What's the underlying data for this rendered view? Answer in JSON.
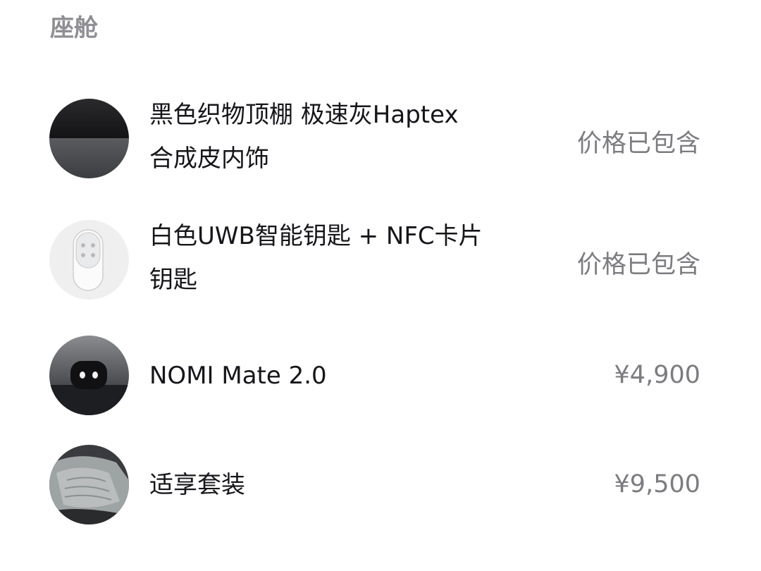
{
  "section": {
    "title": "座舱"
  },
  "items": [
    {
      "name_line1": "黑色织物顶棚 极速灰Haptex",
      "name_line2": "合成皮内饰",
      "price": "价格已包含",
      "image_icon": "black-fabric-headliner-swatch"
    },
    {
      "name_line1": "白色UWB智能钥匙 + NFC卡片",
      "name_line2": "钥匙",
      "price": "价格已包含",
      "image_icon": "white-smart-key"
    },
    {
      "name_line1": "NOMI Mate 2.0",
      "price": "¥4,900",
      "image_icon": "nomi-mate-device"
    },
    {
      "name_line1": "适享套装",
      "price": "¥9,500",
      "image_icon": "seat-package"
    }
  ]
}
